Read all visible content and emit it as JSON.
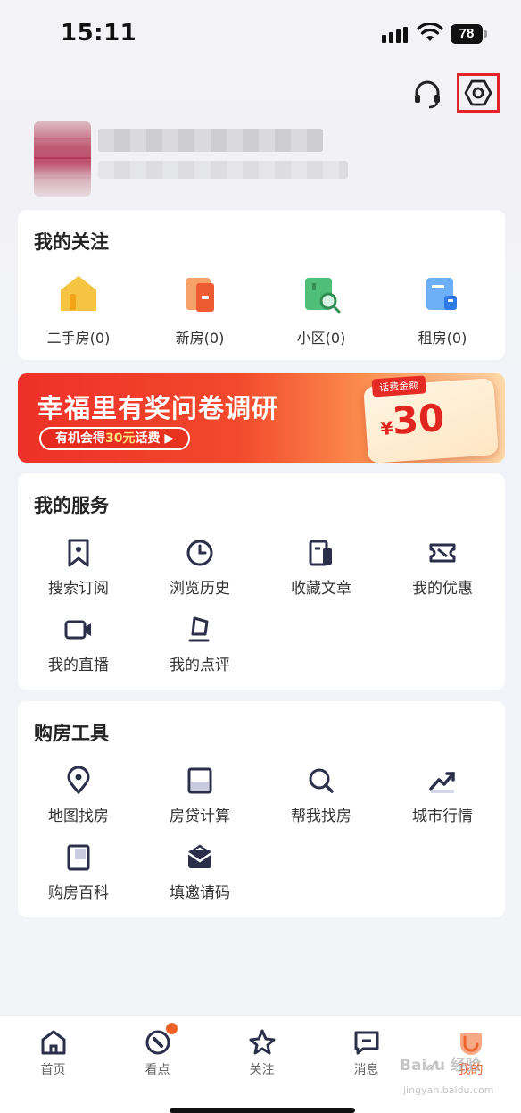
{
  "status_bar": {
    "time": "15:11",
    "battery": "78"
  },
  "header": {
    "support_icon": "headset-icon",
    "settings_icon": "settings-hex-icon",
    "highlight_color": "#e2232a"
  },
  "follow": {
    "title": "我的关注",
    "items": [
      {
        "label": "二手房(0)",
        "icon": "second-hand-house-icon",
        "color": "#f6c443"
      },
      {
        "label": "新房(0)",
        "icon": "new-house-icon",
        "color": "#f07a45"
      },
      {
        "label": "小区(0)",
        "icon": "community-search-icon",
        "color": "#4fbf78"
      },
      {
        "label": "租房(0)",
        "icon": "rent-house-icon",
        "color": "#4c9df5"
      }
    ]
  },
  "banner": {
    "title": "幸福里有奖问卷调研",
    "pill_prefix": "有机会得",
    "pill_highlight": "30元",
    "pill_suffix": "话费 ▶",
    "ticket_tag": "话费金额",
    "ticket_yen": "¥",
    "ticket_amount": "30"
  },
  "services": {
    "title": "我的服务",
    "items": [
      {
        "label": "搜索订阅",
        "icon": "bookmark-icon"
      },
      {
        "label": "浏览历史",
        "icon": "clock-icon"
      },
      {
        "label": "收藏文章",
        "icon": "article-icon"
      },
      {
        "label": "我的优惠",
        "icon": "ticket-icon"
      },
      {
        "label": "我的直播",
        "icon": "video-icon"
      },
      {
        "label": "我的点评",
        "icon": "comment-icon"
      }
    ]
  },
  "tools": {
    "title": "购房工具",
    "items": [
      {
        "label": "地图找房",
        "icon": "map-pin-icon"
      },
      {
        "label": "房贷计算",
        "icon": "calculator-icon"
      },
      {
        "label": "帮我找房",
        "icon": "search-icon"
      },
      {
        "label": "城市行情",
        "icon": "trend-icon"
      },
      {
        "label": "购房百科",
        "icon": "book-icon"
      },
      {
        "label": "填邀请码",
        "icon": "mail-icon"
      }
    ]
  },
  "tabbar": {
    "tabs": [
      {
        "label": "首页",
        "icon": "home-icon"
      },
      {
        "label": "看点",
        "icon": "compass-icon"
      },
      {
        "label": "关注",
        "icon": "star-icon"
      },
      {
        "label": "消息",
        "icon": "message-icon"
      },
      {
        "label": "我的",
        "icon": "profile-icon"
      }
    ],
    "active_color": "#f0622a"
  },
  "watermark": {
    "text": "Bai𝒹u 经验",
    "sub": "jingyan.baidu.com"
  }
}
